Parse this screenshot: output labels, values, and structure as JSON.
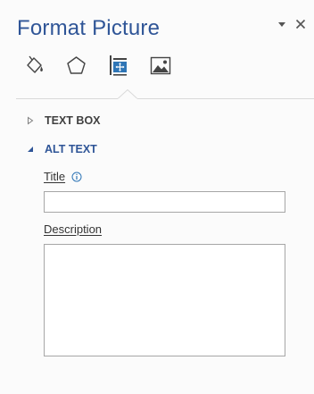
{
  "pane": {
    "title": "Format Picture",
    "controls": [
      {
        "name": "task-pane-options-icon"
      },
      {
        "name": "close-icon"
      }
    ]
  },
  "tabs": [
    {
      "name": "fill-line-icon",
      "selected": false
    },
    {
      "name": "effects-icon",
      "selected": false
    },
    {
      "name": "size-properties-icon",
      "selected": true
    },
    {
      "name": "picture-icon",
      "selected": false
    }
  ],
  "sections": {
    "text_box": {
      "label": "TEXT BOX",
      "expanded": false
    },
    "alt_text": {
      "label": "ALT TEXT",
      "expanded": true
    }
  },
  "alt_text": {
    "title_label": "Title",
    "title_value": "",
    "description_label": "Description",
    "description_value": ""
  },
  "colors": {
    "accent": "#2f5597",
    "pane_background": "#fbfbfb",
    "section_text": "#404040",
    "input_border": "#a6a6a6"
  }
}
